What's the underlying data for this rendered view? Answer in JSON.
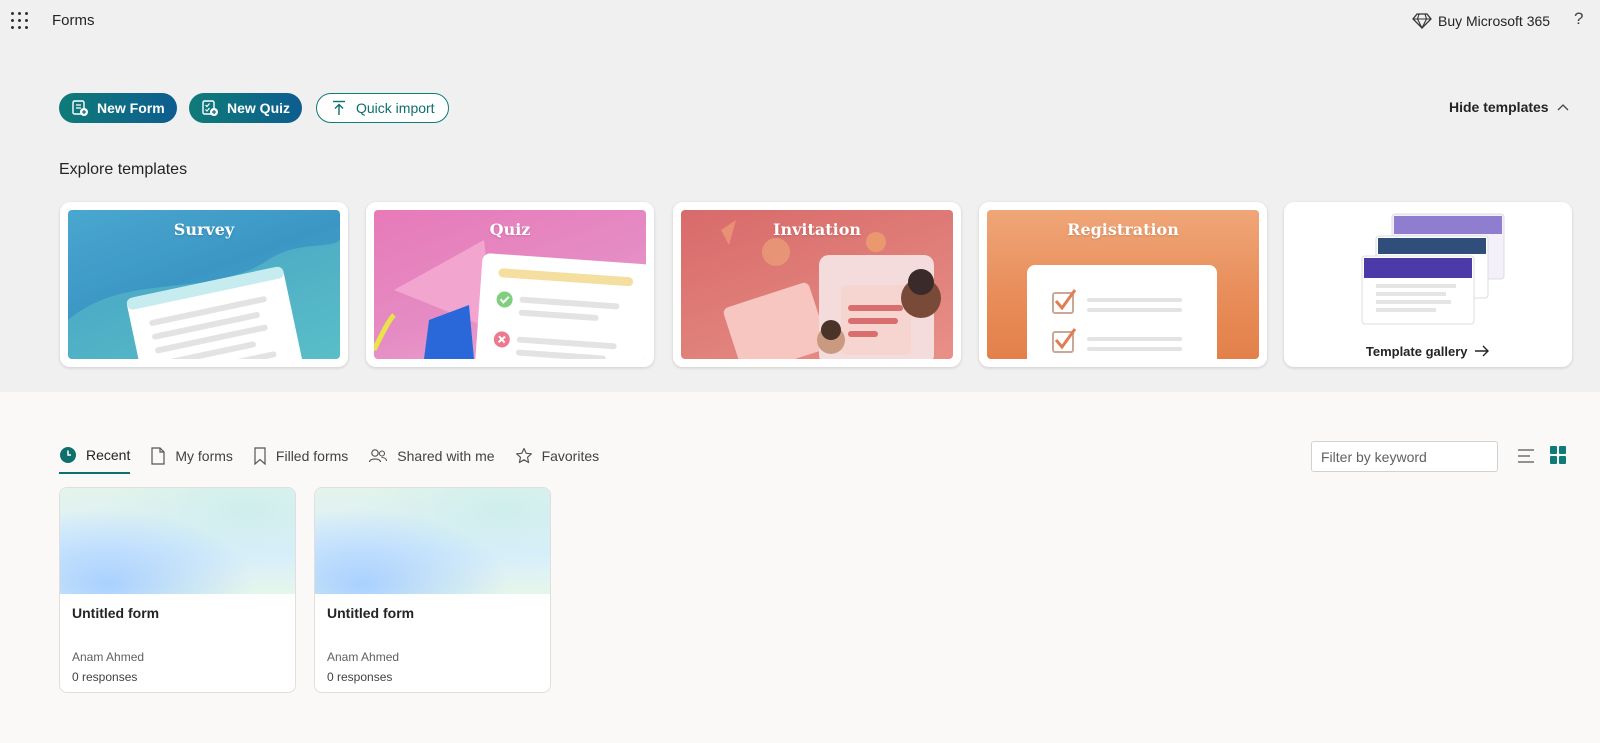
{
  "app": {
    "name": "Forms",
    "buy_label": "Buy Microsoft 365",
    "help_label": "?"
  },
  "actions": {
    "new_form": "New Form",
    "new_quiz": "New Quiz",
    "quick_import": "Quick import",
    "hide_templates": "Hide templates"
  },
  "templates": {
    "heading": "Explore templates",
    "items": [
      {
        "label": "Survey"
      },
      {
        "label": "Quiz"
      },
      {
        "label": "Invitation"
      },
      {
        "label": "Registration"
      }
    ],
    "gallery_label": "Template gallery"
  },
  "tabs": [
    {
      "label": "Recent",
      "active": true
    },
    {
      "label": "My forms"
    },
    {
      "label": "Filled forms"
    },
    {
      "label": "Shared with me"
    },
    {
      "label": "Favorites"
    }
  ],
  "filter": {
    "placeholder": "Filter by keyword"
  },
  "forms": [
    {
      "title": "Untitled form",
      "owner": "Anam Ahmed",
      "responses": "0 responses"
    },
    {
      "title": "Untitled form",
      "owner": "Anam Ahmed",
      "responses": "0 responses"
    }
  ],
  "colors": {
    "accent": "#0f7b78",
    "accent_blue": "#0d5d8f"
  }
}
